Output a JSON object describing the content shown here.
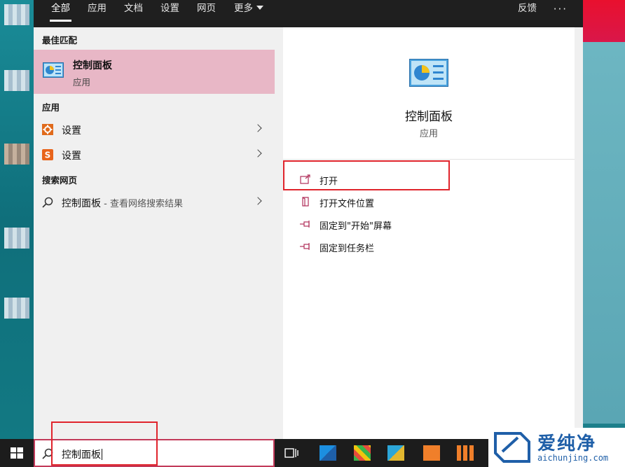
{
  "tabs": {
    "all": "全部",
    "apps": "应用",
    "documents": "文档",
    "settings": "设置",
    "web": "网页",
    "more": "更多",
    "feedback": "反馈",
    "overflow": "···"
  },
  "left": {
    "best_match_header": "最佳匹配",
    "best_match": {
      "title": "控制面板",
      "subtitle": "应用"
    },
    "apps_header": "应用",
    "apps": [
      {
        "label": "设置"
      },
      {
        "label": "设置"
      }
    ],
    "web_header": "搜索网页",
    "web_result": {
      "label": "控制面板",
      "suffix": " - 查看网络搜索结果"
    }
  },
  "right": {
    "title": "控制面板",
    "subtitle": "应用",
    "actions": [
      {
        "label": "打开"
      },
      {
        "label": "打开文件位置"
      },
      {
        "label": "固定到\"开始\"屏幕"
      },
      {
        "label": "固定到任务栏"
      }
    ]
  },
  "taskbar": {
    "search_value": "控制面板"
  },
  "watermark": {
    "brand": "爱纯净",
    "url": "aichunjing.com"
  },
  "colors": {
    "accent_selection": "#e8b7c6",
    "highlight_border": "#e0242c",
    "tabbar": "#1f1f1f"
  }
}
